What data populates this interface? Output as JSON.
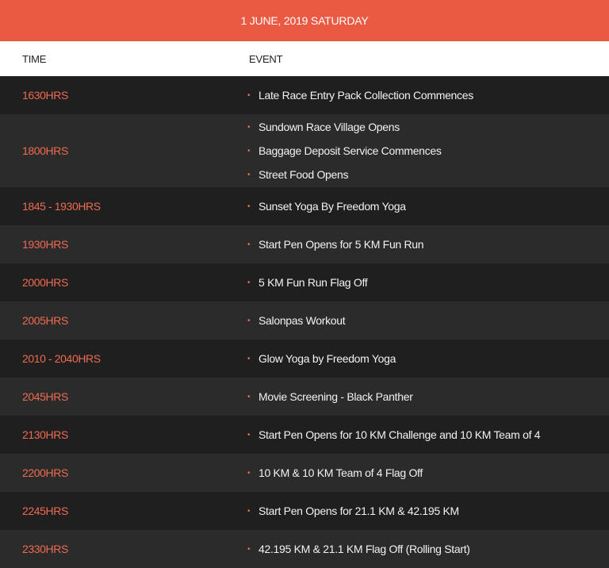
{
  "header": {
    "title": "1 JUNE, 2019 SATURDAY"
  },
  "columns": {
    "time": "TIME",
    "event": "EVENT"
  },
  "rows": [
    {
      "time": "1630HRS",
      "events": [
        "Late Race Entry Pack Collection Commences"
      ]
    },
    {
      "time": "1800HRS",
      "events": [
        "Sundown Race Village Opens",
        "Baggage Deposit Service Commences",
        "Street Food Opens"
      ]
    },
    {
      "time": "1845 - 1930HRS",
      "events": [
        "Sunset Yoga By Freedom Yoga"
      ]
    },
    {
      "time": "1930HRS",
      "events": [
        "Start Pen Opens for 5 KM Fun Run"
      ]
    },
    {
      "time": "2000HRS",
      "events": [
        "5 KM Fun Run Flag Off"
      ]
    },
    {
      "time": "2005HRS",
      "events": [
        "Salonpas Workout"
      ]
    },
    {
      "time": "2010 - 2040HRS",
      "events": [
        "Glow Yoga by Freedom Yoga"
      ]
    },
    {
      "time": "2045HRS",
      "events": [
        "Movie Screening  -  Black Panther"
      ]
    },
    {
      "time": "2130HRS",
      "events": [
        "Start Pen Opens for 10 KM Challenge and 10 KM Team of 4"
      ]
    },
    {
      "time": "2200HRS",
      "events": [
        "10 KM & 10 KM Team of 4 Flag Off"
      ]
    },
    {
      "time": "2245HRS",
      "events": [
        "Start Pen Opens for 21.1 KM & 42.195 KM"
      ]
    },
    {
      "time": "2330HRS",
      "events": [
        "42.195 KM & 21.1 KM Flag Off (Rolling Start)"
      ]
    }
  ],
  "colors": {
    "accent": "#ea5a43",
    "dark_row": "#1f1f1f",
    "light_row": "#2b2b2b"
  },
  "bullet_symbol": "•"
}
